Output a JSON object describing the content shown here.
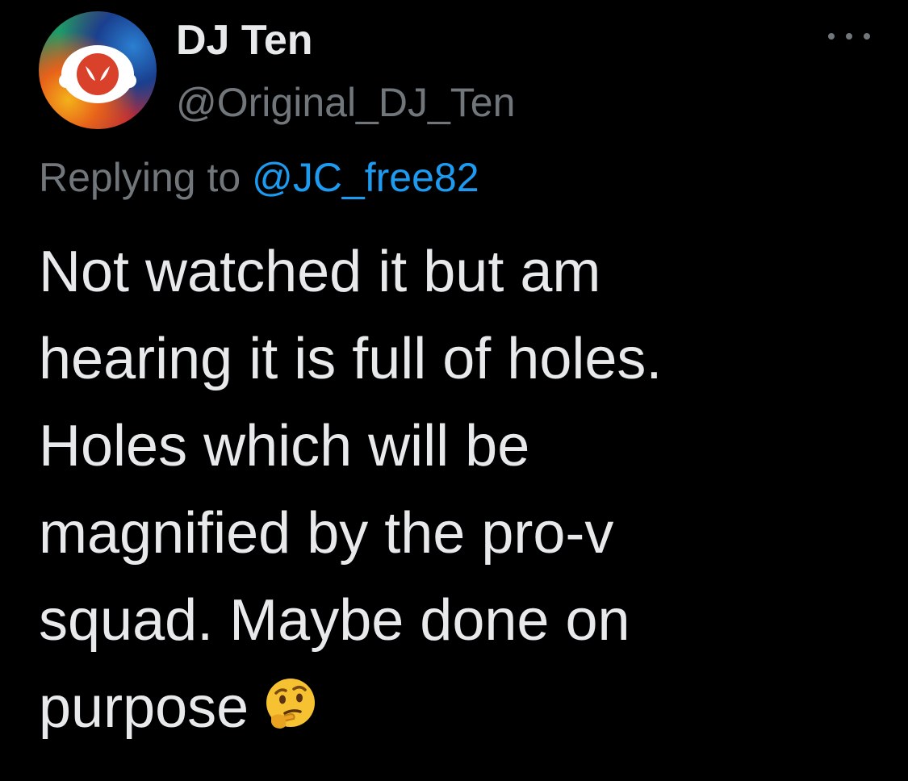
{
  "tweet": {
    "author": {
      "display_name": "DJ Ten",
      "handle": "@Original_DJ_Ten",
      "avatar_icon": "orange-alien-face-avatar"
    },
    "more_icon": "more-horizontal-icon",
    "reply": {
      "prefix": "Replying to",
      "mention": "@JC_free82"
    },
    "body_lines": [
      "Not watched it but am",
      "hearing it is full of holes.",
      "Holes which will be",
      "magnified by the pro-v",
      "squad. Maybe done on",
      "purpose"
    ],
    "emoji": "thinking-face-emoji",
    "colors": {
      "background": "#000000",
      "text_primary": "#e7e9ea",
      "text_secondary": "#71767b",
      "link": "#1d9bf0"
    }
  }
}
